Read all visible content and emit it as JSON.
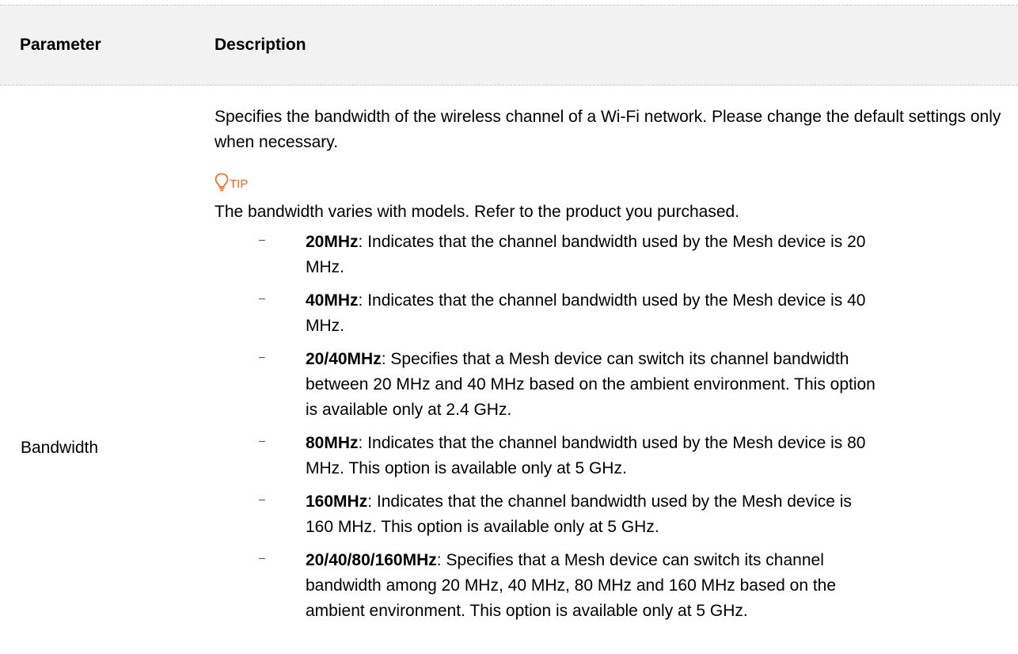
{
  "header": {
    "parameter": "Parameter",
    "description": "Description"
  },
  "row": {
    "parameter": "Bandwidth",
    "intro": "Specifies the bandwidth of the wireless channel of a Wi-Fi network. Please change the default settings only when necessary.",
    "tip_label": "TIP",
    "tip_icon": "lightbulb-icon",
    "tip_text": "The bandwidth varies with models. Refer to the product you purchased.",
    "tip_color": "#f26522",
    "items": [
      {
        "term": "20MHz",
        "text": ": Indicates that the channel bandwidth used by the Mesh device is 20 MHz."
      },
      {
        "term": "40MHz",
        "text": ": Indicates that the channel bandwidth used by the Mesh device is 40 MHz."
      },
      {
        "term": "20/40MHz",
        "text": ": Specifies that a Mesh device can switch its channel bandwidth between 20 MHz and 40 MHz based on the ambient environment. This option is available only at 2.4 GHz."
      },
      {
        "term": "80MHz",
        "text": ": Indicates that the channel bandwidth used by the Mesh device is 80 MHz. This option is available only at 5 GHz."
      },
      {
        "term": "160MHz",
        "text": ": Indicates that the channel bandwidth used by the Mesh device is 160 MHz. This option is available only at 5 GHz."
      },
      {
        "term": "20/40/80/160MHz",
        "text": ": Specifies that a Mesh device can switch its channel bandwidth among 20 MHz, 40 MHz, 80 MHz and 160 MHz based on the ambient environment. This option is available only at 5 GHz."
      }
    ]
  }
}
